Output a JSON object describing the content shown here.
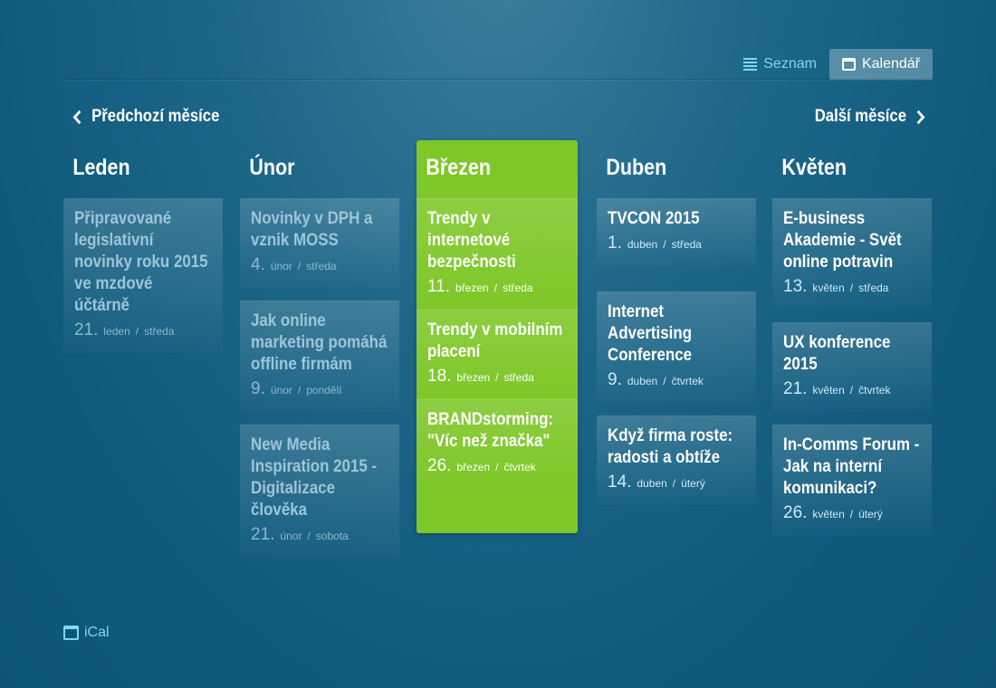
{
  "view_switch": {
    "list_label": "Seznam",
    "calendar_label": "Kalendář"
  },
  "nav": {
    "prev_label": "Předchozí měsíce",
    "next_label": "Další měsíce"
  },
  "columns": [
    {
      "month": "Leden",
      "events": [
        {
          "title": "Připravované legislativní novinky roku 2015 ve mzdové účtárně",
          "day": "21.",
          "month": "leden",
          "weekday": "středa"
        }
      ]
    },
    {
      "month": "Únor",
      "events": [
        {
          "title": "Novinky v DPH a vznik MOSS",
          "day": "4.",
          "month": "únor",
          "weekday": "středa"
        },
        {
          "title": "Jak online marketing pomáhá offline firmám",
          "day": "9.",
          "month": "únor",
          "weekday": "pondělí"
        },
        {
          "title": "New Media Inspiration 2015 - Digitalizace člověka",
          "day": "21.",
          "month": "únor",
          "weekday": "sobota"
        }
      ]
    },
    {
      "month": "Březen",
      "events": [
        {
          "title": "Trendy v internetové bezpečnosti",
          "day": "11.",
          "month": "březen",
          "weekday": "středa"
        },
        {
          "title": "Trendy v mobilním placení",
          "day": "18.",
          "month": "březen",
          "weekday": "středa"
        },
        {
          "title": "BRANDstorming: \"Víc než značka\"",
          "day": "26.",
          "month": "březen",
          "weekday": "čtvrtek"
        }
      ]
    },
    {
      "month": "Duben",
      "events": [
        {
          "title": "TVCON 2015",
          "day": "1.",
          "month": "duben",
          "weekday": "středa"
        },
        {
          "title": "Internet Advertising Conference",
          "day": "9.",
          "month": "duben",
          "weekday": "čtvrtek"
        },
        {
          "title": "Když firma roste: radosti a obtíže",
          "day": "14.",
          "month": "duben",
          "weekday": "úterý"
        }
      ]
    },
    {
      "month": "Květen",
      "events": [
        {
          "title": "E-business Akademie - Svět online potravin",
          "day": "13.",
          "month": "květen",
          "weekday": "středa"
        },
        {
          "title": "UX konference 2015",
          "day": "21.",
          "month": "květen",
          "weekday": "čtvrtek"
        },
        {
          "title": "In-Comms Forum - Jak na interní komunikaci?",
          "day": "26.",
          "month": "květen",
          "weekday": "úterý"
        }
      ]
    }
  ],
  "ical_label": "iCal",
  "colors": {
    "background": "#15617f",
    "current_month": "#7ec728",
    "link": "#7fd8f2"
  }
}
